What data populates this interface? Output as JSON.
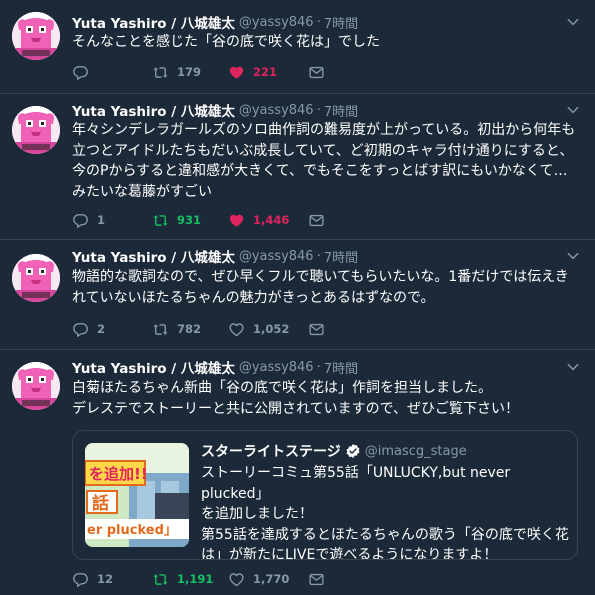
{
  "tweets": [
    {
      "name": "Yuta Yashiro / 八城雄太",
      "handle": "@yassy846",
      "time": "7時間",
      "lines": [
        "そんなことを感じた「谷の底で咲く花は」でした"
      ],
      "reply_count": "",
      "retweet_count": "179",
      "like_count": "221"
    },
    {
      "name": "Yuta Yashiro / 八城雄太",
      "handle": "@yassy846",
      "time": "7時間",
      "lines": [
        "年々シンデレラガールズのソロ曲作詞の難易度が上がっている。初出から何年も",
        "立つとアイドルたちもだいぶ成長していて、ど初期のキャラ付け通りにすると、",
        "今のPからすると違和感が大きくて、でもそこをすっとばす訳にもいかなくて…",
        "みたいな葛藤がすごい"
      ],
      "reply_count": "1",
      "retweet_count": "931",
      "like_count": "1,446"
    },
    {
      "name": "Yuta Yashiro / 八城雄太",
      "handle": "@yassy846",
      "time": "7時間",
      "lines": [
        "物語的な歌詞なので、ぜひ早くフルで聴いてもらいたいな。1番だけでは伝えき",
        "れていないほたるちゃんの魅力がきっとあるはずなので。"
      ],
      "reply_count": "2",
      "retweet_count": "782",
      "like_count": "1,052"
    },
    {
      "name": "Yuta Yashiro / 八城雄太",
      "handle": "@yassy846",
      "time": "7時間",
      "lines": [
        "白菊ほたるちゃん新曲「谷の底で咲く花は」作詞を担当しました。",
        "デレステでストーリーと共に公開されていますので、ぜひご覧下さい！"
      ],
      "reply_count": "12",
      "retweet_count": "1,191",
      "like_count": "1,770",
      "quote": {
        "account": "スターライトステージ",
        "handle": "@imascg_stage",
        "lines": [
          "ストーリーコミュ第55話「UNLUCKY,but never plucked」",
          "を追加しました！",
          "第55話を達成するとほたるちゃんの歌う「谷の底で咲く花",
          "は」が新たにLIVEで遊べるようになりますよ！"
        ],
        "image_text_top": "を追加!!",
        "image_text_mid": "話",
        "image_text_bottom": "er plucked」"
      }
    }
  ],
  "colors": {
    "background": "#1c2938",
    "divider": "#38444d",
    "muted": "#8899a6",
    "retweet_active": "#17bf63",
    "like_active": "#e0245e",
    "verified": "#ffffff"
  },
  "icons": [
    "avatar",
    "chevron-down-icon",
    "reply-icon",
    "retweet-icon",
    "heart-icon",
    "dm-icon",
    "verified-icon"
  ]
}
